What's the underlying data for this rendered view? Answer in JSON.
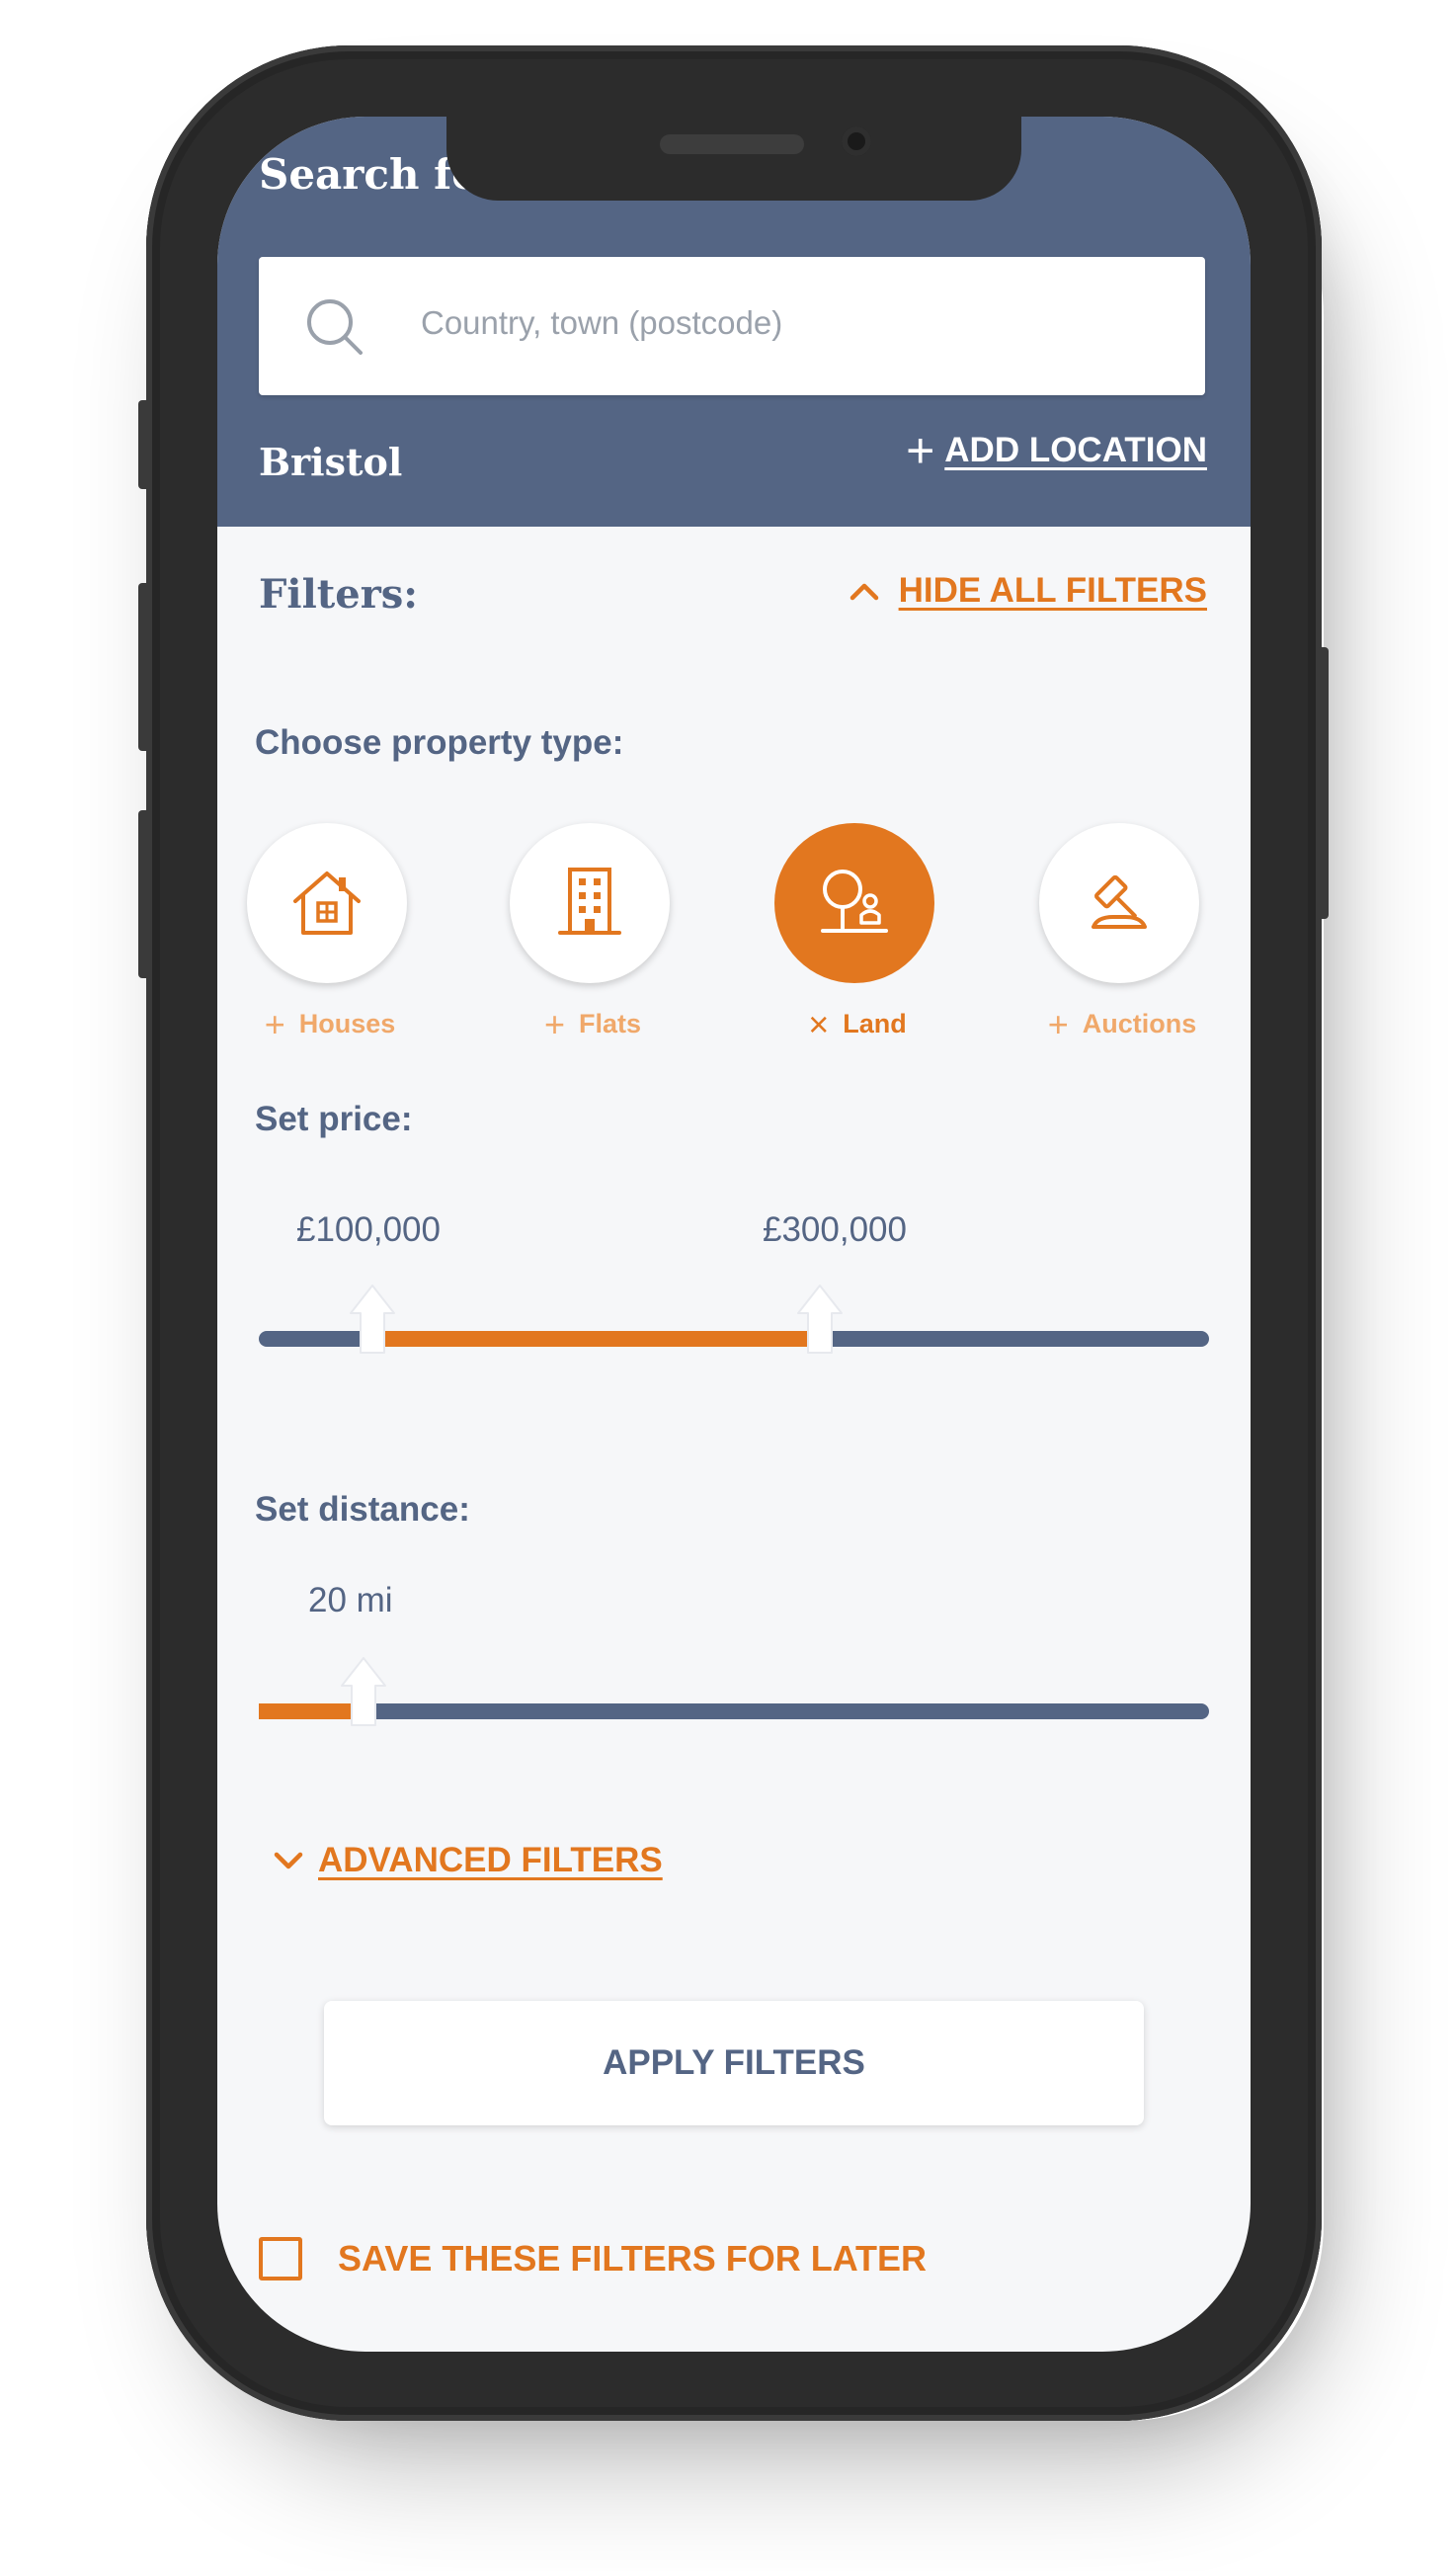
{
  "header": {
    "title": "Search for",
    "search_placeholder": "Country, town (postcode)",
    "location": "Bristol",
    "add_location_label": "ADD LOCATION"
  },
  "filters": {
    "title": "Filters:",
    "hide_all_label": "HIDE ALL FILTERS",
    "property_type_label": "Choose property type:",
    "property_types": [
      {
        "label": "Houses",
        "icon": "house-icon",
        "selected": false,
        "sign": "+"
      },
      {
        "label": "Flats",
        "icon": "flats-building-icon",
        "selected": false,
        "sign": "+"
      },
      {
        "label": "Land",
        "icon": "land-tree-icon",
        "selected": true,
        "sign": "×"
      },
      {
        "label": "Auctions",
        "icon": "auction-gavel-icon",
        "selected": false,
        "sign": "+"
      }
    ],
    "price": {
      "label": "Set price:",
      "min_label": "£100,000",
      "max_label": "£300,000",
      "min_fraction": 0.12,
      "max_fraction": 0.59
    },
    "distance": {
      "label": "Set distance:",
      "value_label": "20 mi",
      "fraction": 0.11
    },
    "advanced_label": "ADVANCED FILTERS",
    "apply_label": "APPLY FILTERS",
    "save_label": "SAVE THESE FILTERS FOR LATER",
    "save_checked": false
  },
  "colors": {
    "header_bg": "#546584",
    "accent": "#e2771f",
    "text_primary": "#546584",
    "screen_bg": "#f6f7f9"
  }
}
